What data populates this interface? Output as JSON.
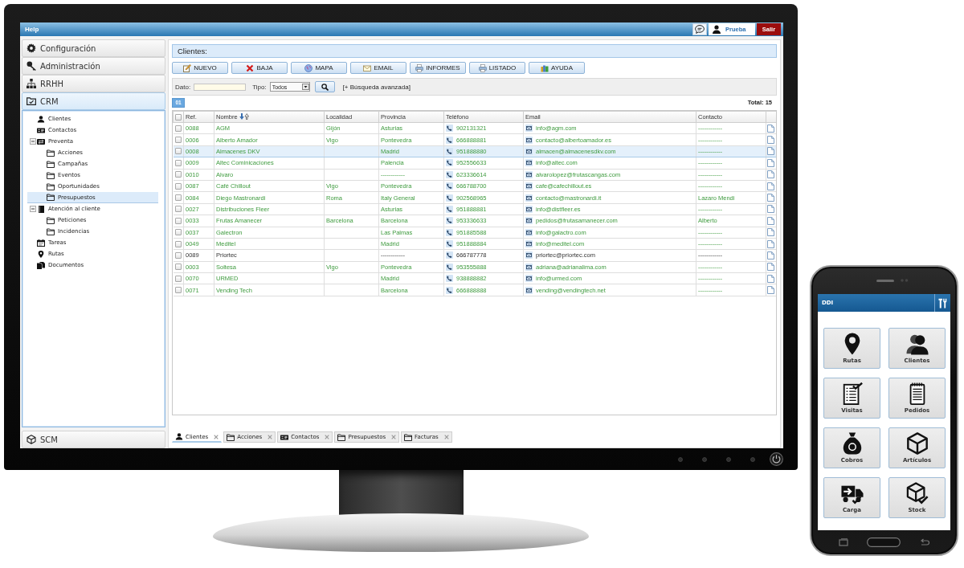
{
  "top_bar": {
    "title": "Help",
    "user": "Prueba",
    "logout": "Salir"
  },
  "sidebar": {
    "sections": [
      {
        "label": "Configuración",
        "expanded": false
      },
      {
        "label": "Administración",
        "expanded": false
      },
      {
        "label": "RRHH",
        "expanded": false
      },
      {
        "label": "CRM",
        "expanded": true,
        "tree": [
          {
            "label": "Clientes",
            "selected": false
          },
          {
            "label": "Contactos",
            "selected": false
          },
          {
            "label": "Preventa",
            "selected": false,
            "expanded": true,
            "children": [
              {
                "label": "Acciones",
                "selected": false
              },
              {
                "label": "Campañas",
                "selected": false
              },
              {
                "label": "Eventos",
                "selected": false
              },
              {
                "label": "Oportunidades",
                "selected": false
              },
              {
                "label": "Presupuestos",
                "selected": true
              }
            ]
          },
          {
            "label": "Atención al cliente",
            "selected": false,
            "expanded": true,
            "children": [
              {
                "label": "Peticiones",
                "selected": false
              },
              {
                "label": "Incidencias",
                "selected": false
              }
            ]
          },
          {
            "label": "Tareas",
            "selected": false
          },
          {
            "label": "Rutas",
            "selected": false
          },
          {
            "label": "Documentos",
            "selected": false
          }
        ]
      },
      {
        "label": "SCM",
        "expanded": false
      }
    ]
  },
  "main": {
    "title": "Clientes:",
    "toolbar": [
      "NUEVO",
      "BAJA",
      "MAPA",
      "EMAIL",
      "INFORMES",
      "LISTADO",
      "AYUDA"
    ],
    "filter": {
      "dato_label": "Dato:",
      "tipo_label": "Tipo:",
      "tipo_value": "Todos",
      "advanced_search": "[+ Búsqueda avanzada]"
    },
    "pager": {
      "pages": [
        {
          "label": "01",
          "selected": true
        }
      ],
      "total": "Total: 15"
    },
    "table": {
      "all_checked": false,
      "columns": [
        {
          "label": "Ref.",
          "sorted": false
        },
        {
          "label": "Nombre",
          "sorted": true
        },
        {
          "label": "Localidad",
          "sorted": false
        },
        {
          "label": "Provincia",
          "sorted": false
        },
        {
          "label": "Teléfono",
          "sorted": false
        },
        {
          "label": "Email",
          "sorted": false
        },
        {
          "label": "Contacto",
          "sorted": false
        }
      ],
      "rows": [
        {
          "checked": false,
          "selected": false,
          "active": true,
          "ref": "0088",
          "nombre": "AGM",
          "localidad": "Gijón",
          "provincia": "Asturias",
          "telefono": "902131321",
          "email": "info@agm.com",
          "contacto": "------------"
        },
        {
          "checked": false,
          "selected": false,
          "active": true,
          "ref": "0006",
          "nombre": "Alberto Amador",
          "localidad": "Vigo",
          "provincia": "Pontevedra",
          "telefono": "666888881",
          "email": "contacto@albertoamador.es",
          "contacto": "------------"
        },
        {
          "checked": false,
          "selected": true,
          "active": true,
          "ref": "0008",
          "nombre": "Almacenes DKV",
          "provincia": "Madrid",
          "telefono": "951888880",
          "email": "almacen@almacenesdkv.com",
          "contacto": "------------"
        },
        {
          "checked": false,
          "selected": false,
          "active": true,
          "ref": "0009",
          "nombre": "Altec Cominicaciones",
          "provincia": "Palencia",
          "telefono": "952556633",
          "email": "info@altec.com",
          "contacto": "------------"
        },
        {
          "checked": false,
          "selected": false,
          "active": true,
          "ref": "0010",
          "nombre": "Alvaro",
          "provincia": "------------",
          "telefono": "623336614",
          "email": "alvarolopez@frutascangas.com",
          "contacto": "------------"
        },
        {
          "checked": false,
          "selected": false,
          "active": true,
          "ref": "0087",
          "nombre": "Café Chillout",
          "localidad": "Vigo",
          "provincia": "Pontevedra",
          "telefono": "666788700",
          "email": "cafe@cafechillout.es",
          "contacto": "------------"
        },
        {
          "checked": false,
          "selected": false,
          "active": true,
          "ref": "0084",
          "nombre": "Diego Mastronardi",
          "localidad": "Roma",
          "provincia": "Italy General",
          "telefono": "902568965",
          "email": "contacto@mastronardi.it",
          "contacto": "Lazaro Mendi"
        },
        {
          "checked": false,
          "selected": false,
          "active": true,
          "ref": "0027",
          "nombre": "Distribuciones Fleer",
          "provincia": "Asturias",
          "telefono": "951888881",
          "email": "info@distfleer.es",
          "contacto": "------------"
        },
        {
          "checked": false,
          "selected": false,
          "active": true,
          "ref": "0033",
          "nombre": "Frutas Amanecer",
          "localidad": "Barcelona",
          "provincia": "Barcelona",
          "telefono": "953336633",
          "email": "pedidos@frutasamanecer.com",
          "contacto": "Alberto"
        },
        {
          "checked": false,
          "selected": false,
          "active": true,
          "ref": "0037",
          "nombre": "Galectron",
          "provincia": "Las Palmas",
          "telefono": "951885588",
          "email": "info@galactro.com",
          "contacto": "------------"
        },
        {
          "checked": false,
          "selected": false,
          "active": true,
          "ref": "0049",
          "nombre": "Meditel",
          "provincia": "Madrid",
          "telefono": "951888884",
          "email": "info@meditel.com",
          "contacto": "------------"
        },
        {
          "checked": false,
          "selected": false,
          "active": false,
          "ref": "0089",
          "nombre": "Priortec",
          "provincia": "------------",
          "telefono": "666787778",
          "email": "priortec@priortec.com",
          "contacto": "------------"
        },
        {
          "checked": false,
          "selected": false,
          "active": true,
          "ref": "0003",
          "nombre": "Soltesa",
          "localidad": "Vigo",
          "provincia": "Pontevedra",
          "telefono": "953555888",
          "email": "adriana@adrianalima.com",
          "contacto": "------------"
        },
        {
          "checked": false,
          "selected": false,
          "active": true,
          "ref": "0070",
          "nombre": "URMED",
          "provincia": "Madrid",
          "telefono": "938888882",
          "email": "info@urmed.com",
          "contacto": "------------"
        },
        {
          "checked": false,
          "selected": false,
          "active": true,
          "ref": "0071",
          "nombre": "Vending Tech",
          "provincia": "Barcelona",
          "telefono": "666888888",
          "email": "vending@vendingtech.net",
          "contacto": "------------"
        }
      ]
    }
  },
  "bottom_tabs": [
    {
      "label": "Clientes",
      "selected": true
    },
    {
      "label": "Acciones",
      "selected": false
    },
    {
      "label": "Contactos",
      "selected": false
    },
    {
      "label": "Presupuestos",
      "selected": false
    },
    {
      "label": "Facturas",
      "selected": false
    }
  ],
  "phone": {
    "title": "DDI",
    "tiles": [
      "Rutas",
      "Clientes",
      "Visitas",
      "Pedidos",
      "Cobros",
      "Artículos",
      "Carga",
      "Stock"
    ]
  }
}
